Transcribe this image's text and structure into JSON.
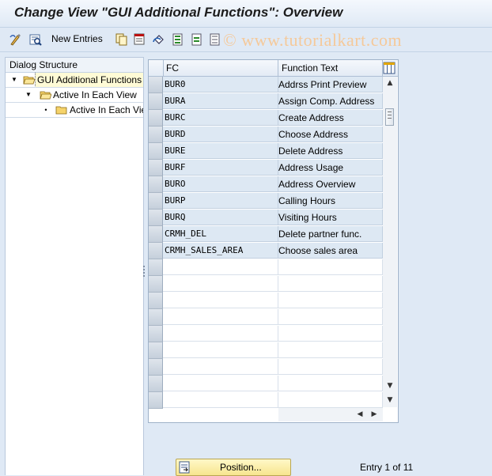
{
  "window": {
    "title": "Change View \"GUI Additional Functions\": Overview"
  },
  "toolbar": {
    "new_entries_label": "New Entries",
    "watermark": "© www.tutorialkart.com"
  },
  "dialog_structure": {
    "header": "Dialog Structure",
    "items": [
      {
        "label": "GUI Additional Functions",
        "level": 0,
        "expanded": true,
        "selected": true
      },
      {
        "label": "Active In Each View",
        "level": 1,
        "expanded": true,
        "selected": false
      },
      {
        "label": "Active In Each View",
        "level": 2,
        "expanded": false,
        "selected": false
      }
    ]
  },
  "table": {
    "columns": [
      "FC",
      "Function Text"
    ],
    "rows": [
      {
        "fc": "BUR0",
        "text": "Addrss Print Preview"
      },
      {
        "fc": "BURA",
        "text": "Assign Comp. Address"
      },
      {
        "fc": "BURC",
        "text": "Create Address"
      },
      {
        "fc": "BURD",
        "text": "Choose Address"
      },
      {
        "fc": "BURE",
        "text": "Delete Address"
      },
      {
        "fc": "BURF",
        "text": "Address Usage"
      },
      {
        "fc": "BURO",
        "text": "Address Overview"
      },
      {
        "fc": "BURP",
        "text": "Calling Hours"
      },
      {
        "fc": "BURQ",
        "text": "Visiting Hours"
      },
      {
        "fc": "CRMH_DEL",
        "text": "Delete partner func."
      },
      {
        "fc": "CRMH_SALES_AREA",
        "text": "Choose sales area"
      }
    ],
    "visible_row_count": 20
  },
  "footer": {
    "position_label": "Position...",
    "entry_info": "Entry 1 of 11"
  },
  "colors": {
    "background": "#dfe9f5",
    "row_filled": "#dde8f3",
    "position_button": "#f7e58e"
  }
}
